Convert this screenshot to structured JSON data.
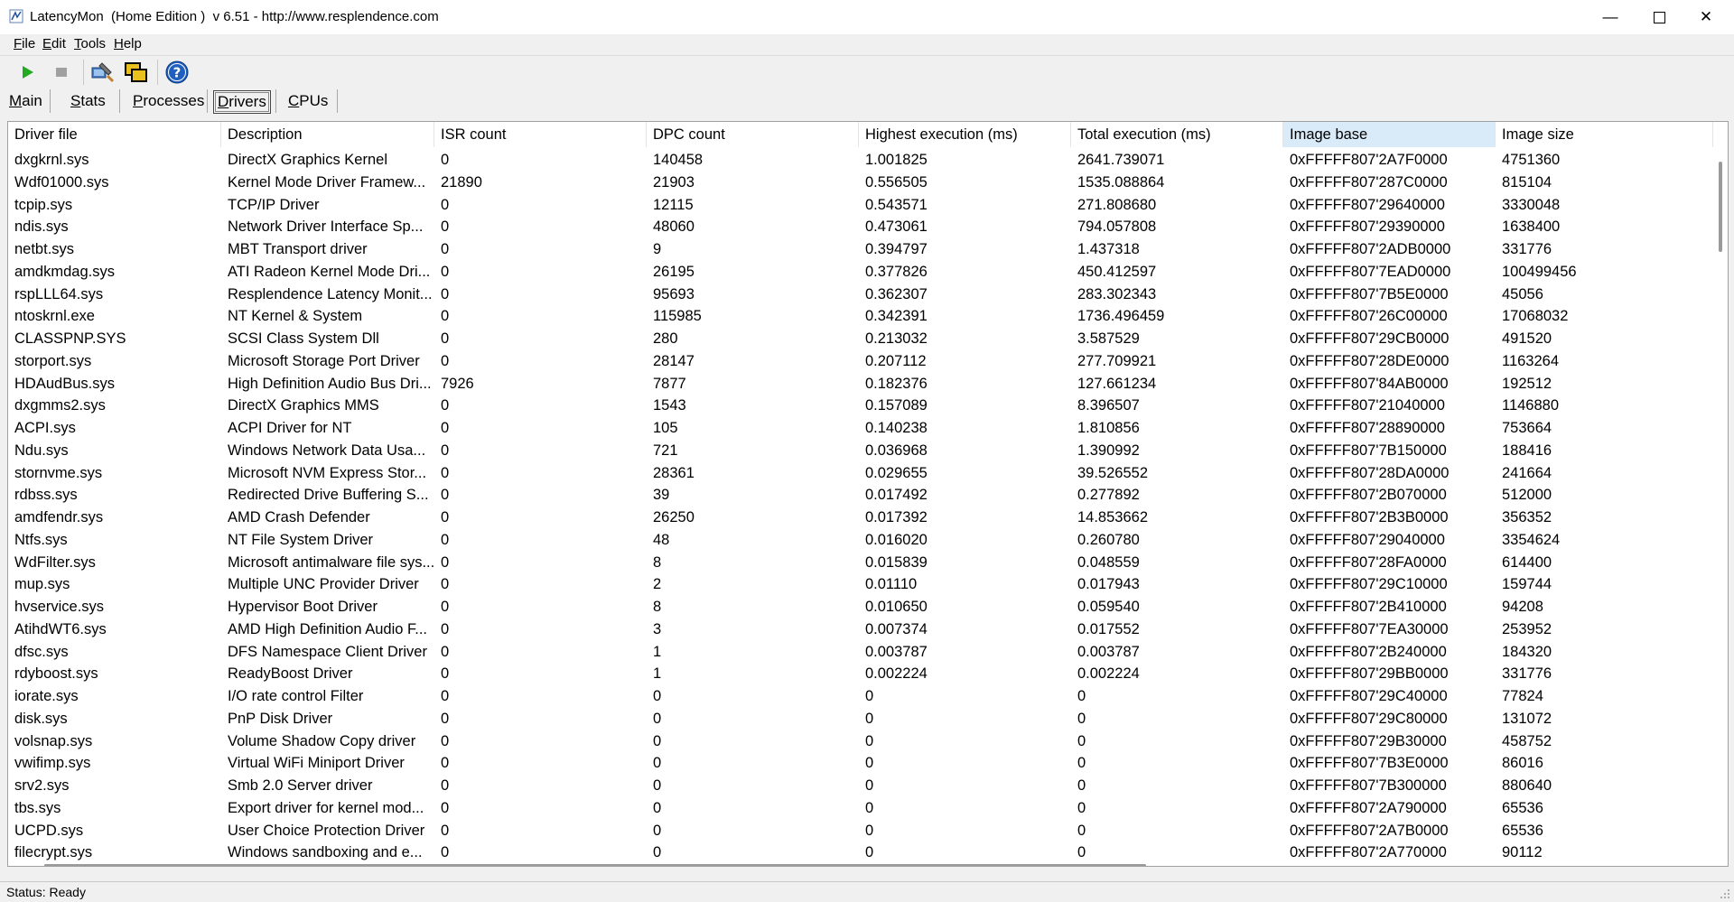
{
  "window": {
    "title": "LatencyMon  (Home Edition )  v 6.51 - http://www.resplendence.com",
    "minimize": "—",
    "close": "✕"
  },
  "menu": {
    "file": {
      "ul": "F",
      "rest": "ile"
    },
    "edit": {
      "ul": "E",
      "rest": "dit"
    },
    "tools": {
      "ul": "T",
      "rest": "ools"
    },
    "help": {
      "ul": "H",
      "rest": "elp"
    }
  },
  "toolbar": {
    "icons": [
      "play-icon",
      "stop-icon",
      "driver-wizard-icon",
      "windows-icon",
      "help-icon"
    ],
    "colors": {
      "play": "#22aa22",
      "stop": "#a0a0a0",
      "help": "#1f5fbf"
    }
  },
  "tabs": [
    {
      "ul": "M",
      "rest": "ain"
    },
    {
      "ul": "S",
      "rest": "tats"
    },
    {
      "ul": "P",
      "rest": "rocesses"
    },
    {
      "ul": "D",
      "rest": "rivers",
      "selected": true
    },
    {
      "ul": "C",
      "rest": "PUs"
    }
  ],
  "table": {
    "columns": [
      "Driver file",
      "Description",
      "ISR count",
      "DPC count",
      "Highest execution (ms)",
      "Total execution (ms)",
      "Image base",
      "Image size"
    ],
    "sorted_column": "Image base",
    "rows": [
      [
        "dxgkrnl.sys",
        "DirectX Graphics Kernel",
        "0",
        "140458",
        "1.001825",
        "2641.739071",
        "0xFFFFF807'2A7F0000",
        "4751360"
      ],
      [
        "Wdf01000.sys",
        "Kernel Mode Driver Framew...",
        "21890",
        "21903",
        "0.556505",
        "1535.088864",
        "0xFFFFF807'287C0000",
        "815104"
      ],
      [
        "tcpip.sys",
        "TCP/IP Driver",
        "0",
        "12115",
        "0.543571",
        "271.808680",
        "0xFFFFF807'29640000",
        "3330048"
      ],
      [
        "ndis.sys",
        "Network Driver Interface Sp...",
        "0",
        "48060",
        "0.473061",
        "794.057808",
        "0xFFFFF807'29390000",
        "1638400"
      ],
      [
        "netbt.sys",
        "MBT Transport driver",
        "0",
        "9",
        "0.394797",
        "1.437318",
        "0xFFFFF807'2ADB0000",
        "331776"
      ],
      [
        "amdkmdag.sys",
        "ATI Radeon Kernel Mode Dri...",
        "0",
        "26195",
        "0.377826",
        "450.412597",
        "0xFFFFF807'7EAD0000",
        "100499456"
      ],
      [
        "rspLLL64.sys",
        "Resplendence Latency Monit...",
        "0",
        "95693",
        "0.362307",
        "283.302343",
        "0xFFFFF807'7B5E0000",
        "45056"
      ],
      [
        "ntoskrnl.exe",
        "NT Kernel & System",
        "0",
        "115985",
        "0.342391",
        "1736.496459",
        "0xFFFFF807'26C00000",
        "17068032"
      ],
      [
        "CLASSPNP.SYS",
        "SCSI Class System Dll",
        "0",
        "280",
        "0.213032",
        "3.587529",
        "0xFFFFF807'29CB0000",
        "491520"
      ],
      [
        "storport.sys",
        "Microsoft Storage Port Driver",
        "0",
        "28147",
        "0.207112",
        "277.709921",
        "0xFFFFF807'28DE0000",
        "1163264"
      ],
      [
        "HDAudBus.sys",
        "High Definition Audio Bus Dri...",
        "7926",
        "7877",
        "0.182376",
        "127.661234",
        "0xFFFFF807'84AB0000",
        "192512"
      ],
      [
        "dxgmms2.sys",
        "DirectX Graphics MMS",
        "0",
        "1543",
        "0.157089",
        "8.396507",
        "0xFFFFF807'21040000",
        "1146880"
      ],
      [
        "ACPI.sys",
        "ACPI Driver for NT",
        "0",
        "105",
        "0.140238",
        "1.810856",
        "0xFFFFF807'28890000",
        "753664"
      ],
      [
        "Ndu.sys",
        "Windows Network Data Usa...",
        "0",
        "721",
        "0.036968",
        "1.390992",
        "0xFFFFF807'7B150000",
        "188416"
      ],
      [
        "stornvme.sys",
        "Microsoft NVM Express Stor...",
        "0",
        "28361",
        "0.029655",
        "39.526552",
        "0xFFFFF807'28DA0000",
        "241664"
      ],
      [
        "rdbss.sys",
        "Redirected Drive Buffering S...",
        "0",
        "39",
        "0.017492",
        "0.277892",
        "0xFFFFF807'2B070000",
        "512000"
      ],
      [
        "amdfendr.sys",
        "AMD Crash Defender",
        "0",
        "26250",
        "0.017392",
        "14.853662",
        "0xFFFFF807'2B3B0000",
        "356352"
      ],
      [
        "Ntfs.sys",
        "NT File System Driver",
        "0",
        "48",
        "0.016020",
        "0.260780",
        "0xFFFFF807'29040000",
        "3354624"
      ],
      [
        "WdFilter.sys",
        "Microsoft antimalware file sys...",
        "0",
        "8",
        "0.015839",
        "0.048559",
        "0xFFFFF807'28FA0000",
        "614400"
      ],
      [
        "mup.sys",
        "Multiple UNC Provider Driver",
        "0",
        "2",
        "0.01110",
        "0.017943",
        "0xFFFFF807'29C10000",
        "159744"
      ],
      [
        "hvservice.sys",
        "Hypervisor Boot Driver",
        "0",
        "8",
        "0.010650",
        "0.059540",
        "0xFFFFF807'2B410000",
        "94208"
      ],
      [
        "AtihdWT6.sys",
        "AMD High Definition Audio F...",
        "0",
        "3",
        "0.007374",
        "0.017552",
        "0xFFFFF807'7EA30000",
        "253952"
      ],
      [
        "dfsc.sys",
        "DFS Namespace Client Driver",
        "0",
        "1",
        "0.003787",
        "0.003787",
        "0xFFFFF807'2B240000",
        "184320"
      ],
      [
        "rdyboost.sys",
        "ReadyBoost Driver",
        "0",
        "1",
        "0.002224",
        "0.002224",
        "0xFFFFF807'29BB0000",
        "331776"
      ],
      [
        "iorate.sys",
        "I/O rate control Filter",
        "0",
        "0",
        "0",
        "0",
        "0xFFFFF807'29C40000",
        "77824"
      ],
      [
        "disk.sys",
        "PnP Disk Driver",
        "0",
        "0",
        "0",
        "0",
        "0xFFFFF807'29C80000",
        "131072"
      ],
      [
        "volsnap.sys",
        "Volume Shadow Copy driver",
        "0",
        "0",
        "0",
        "0",
        "0xFFFFF807'29B30000",
        "458752"
      ],
      [
        "vwifimp.sys",
        "Virtual WiFi Miniport Driver",
        "0",
        "0",
        "0",
        "0",
        "0xFFFFF807'7B3E0000",
        "86016"
      ],
      [
        "srv2.sys",
        "Smb 2.0 Server driver",
        "0",
        "0",
        "0",
        "0",
        "0xFFFFF807'7B300000",
        "880640"
      ],
      [
        "tbs.sys",
        "Export driver for kernel mod...",
        "0",
        "0",
        "0",
        "0",
        "0xFFFFF807'2A790000",
        "65536"
      ],
      [
        "UCPD.sys",
        "User Choice Protection Driver",
        "0",
        "0",
        "0",
        "0",
        "0xFFFFF807'2A7B0000",
        "65536"
      ],
      [
        "filecrypt.sys",
        "Windows sandboxing and e...",
        "0",
        "0",
        "0",
        "0",
        "0xFFFFF807'2A770000",
        "90112"
      ]
    ]
  },
  "status": {
    "text": "Status: Ready"
  }
}
